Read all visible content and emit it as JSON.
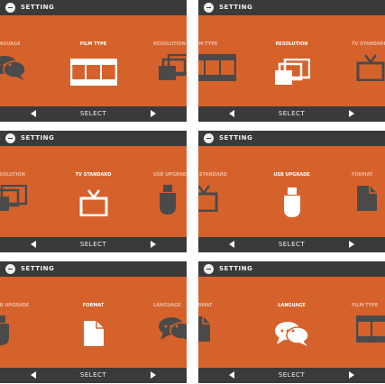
{
  "colors": {
    "screen_bg": "#d6622b",
    "bar_bg": "#3a3a3a",
    "active_icon": "#ffffff",
    "inactive_icon": "#4a4a4a"
  },
  "screens": [
    {
      "title": "SETTING",
      "left_label": "LANGUAGE",
      "center_label": "FILM TYPE",
      "right_label": "RESOLUTION",
      "bottom": "SELECT",
      "left_icon": "language-icon",
      "center_icon": "film-type-icon",
      "right_icon": "resolution-icon"
    },
    {
      "title": "SETTING",
      "left_label": "FILM TYPE",
      "center_label": "RESOLUTION",
      "right_label": "TV STANDARD",
      "bottom": "SELECT",
      "left_icon": "film-type-icon",
      "center_icon": "resolution-icon",
      "right_icon": "tv-standard-icon"
    },
    {
      "title": "SETTING",
      "left_label": "RESOLUTION",
      "center_label": "TV STANDARD",
      "right_label": "USB UPGRADE",
      "bottom": "SELECT",
      "left_icon": "resolution-icon",
      "center_icon": "tv-standard-icon",
      "right_icon": "usb-icon"
    },
    {
      "title": "SETTING",
      "left_label": "TV STANDARD",
      "center_label": "USB UPGRADE",
      "right_label": "FORMAT",
      "bottom": "SELECT",
      "left_icon": "tv-standard-icon",
      "center_icon": "usb-icon",
      "right_icon": "format-icon"
    },
    {
      "title": "SETTING",
      "left_label": "USB UPGRADE",
      "center_label": "FORMAT",
      "right_label": "LANGUAGE",
      "bottom": "SELECT",
      "left_icon": "usb-icon",
      "center_icon": "format-icon",
      "right_icon": "language-icon"
    },
    {
      "title": "SETTING",
      "left_label": "FORMAT",
      "center_label": "LANGUAGE",
      "right_label": "FILM TYPE",
      "bottom": "SELECT",
      "left_icon": "format-icon",
      "center_icon": "language-icon",
      "right_icon": "film-type-icon"
    }
  ]
}
